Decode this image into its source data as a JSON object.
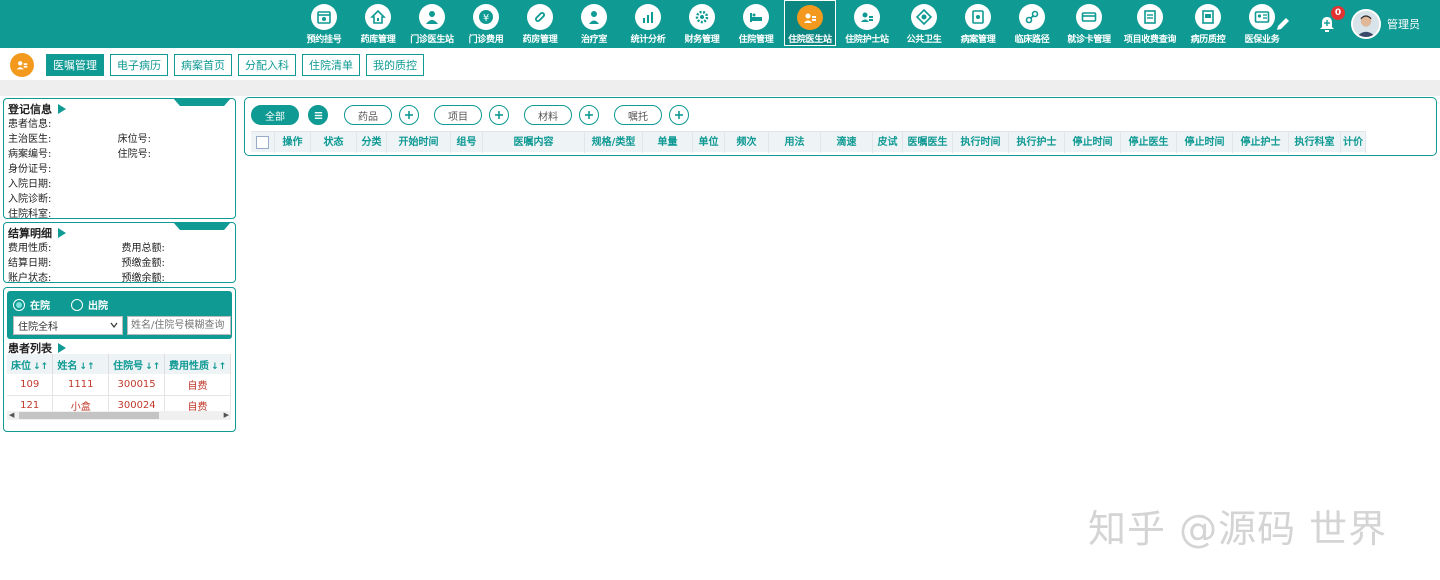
{
  "nav": [
    {
      "label": "预约挂号",
      "icon": "calendar-icon"
    },
    {
      "label": "药库管理",
      "icon": "house-icon"
    },
    {
      "label": "门诊医生站",
      "icon": "doctor-icon"
    },
    {
      "label": "门诊费用",
      "icon": "yen-icon"
    },
    {
      "label": "药房管理",
      "icon": "pill-icon"
    },
    {
      "label": "治疗室",
      "icon": "nurse-icon"
    },
    {
      "label": "统计分析",
      "icon": "chart-icon"
    },
    {
      "label": "财务管理",
      "icon": "gear-icon"
    },
    {
      "label": "住院管理",
      "icon": "bed-icon"
    },
    {
      "label": "住院医生站",
      "icon": "doctor-badge-icon"
    },
    {
      "label": "住院护士站",
      "icon": "nurse-badge-icon"
    },
    {
      "label": "公共卫生",
      "icon": "target-icon"
    },
    {
      "label": "病案管理",
      "icon": "folder-icon"
    },
    {
      "label": "临床路径",
      "icon": "path-icon"
    },
    {
      "label": "就诊卡管理",
      "icon": "card-icon"
    },
    {
      "label": "项目收费查询",
      "icon": "doc-search-icon"
    },
    {
      "label": "病历质控",
      "icon": "record-icon"
    },
    {
      "label": "医保业务",
      "icon": "id-card-icon"
    }
  ],
  "user": {
    "name": "管理员",
    "notifications": "0"
  },
  "tabs": [
    "医嘱管理",
    "电子病历",
    "病案首页",
    "分配入科",
    "住院清单",
    "我的质控"
  ],
  "registration": {
    "title": "登记信息",
    "patient_info": "患者信息:",
    "attending": "主治医生:",
    "bed_no": "床位号:",
    "case_no": "病案编号:",
    "inpatient_no": "住院号:",
    "id_no": "身份证号:",
    "admit_date": "入院日期:",
    "admit_diag": "入院诊断:",
    "dept": "住院科室:"
  },
  "settlement": {
    "title": "结算明细",
    "fee_type": "费用性质:",
    "fee_total": "费用总额:",
    "settle_date": "结算日期:",
    "prepay": "预缴金额:",
    "account_status": "账户状态:",
    "prepay_balance": "预缴余额:"
  },
  "patient_filter": {
    "in_hospital": "在院",
    "discharged": "出院",
    "dept_select": "住院全科",
    "search_placeholder": "姓名/住院号模糊查询"
  },
  "patient_list": {
    "title": "患者列表",
    "columns": [
      "床位",
      "姓名",
      "住院号",
      "费用性质"
    ],
    "rows": [
      [
        "109",
        "1111",
        "300015",
        "自费"
      ],
      [
        "121",
        "小盒",
        "300024",
        "自费"
      ]
    ]
  },
  "filters": {
    "all": "全部",
    "drug": "药品",
    "item": "项目",
    "material": "材料",
    "instruction": "嘱托"
  },
  "order_columns": [
    "操作",
    "状态",
    "分类",
    "开始时间",
    "组号",
    "医嘱内容",
    "规格/类型",
    "单量",
    "单位",
    "频次",
    "用法",
    "滴速",
    "皮试",
    "医嘱医生",
    "执行时间",
    "执行护士",
    "停止时间",
    "停止医生",
    "停止时间",
    "停止护士",
    "执行科室",
    "计价"
  ],
  "watermark": "知乎 @源码 世界",
  "colors": {
    "primary": "#0f9a93",
    "accent": "#f39a1e",
    "danger": "#c0392b"
  }
}
